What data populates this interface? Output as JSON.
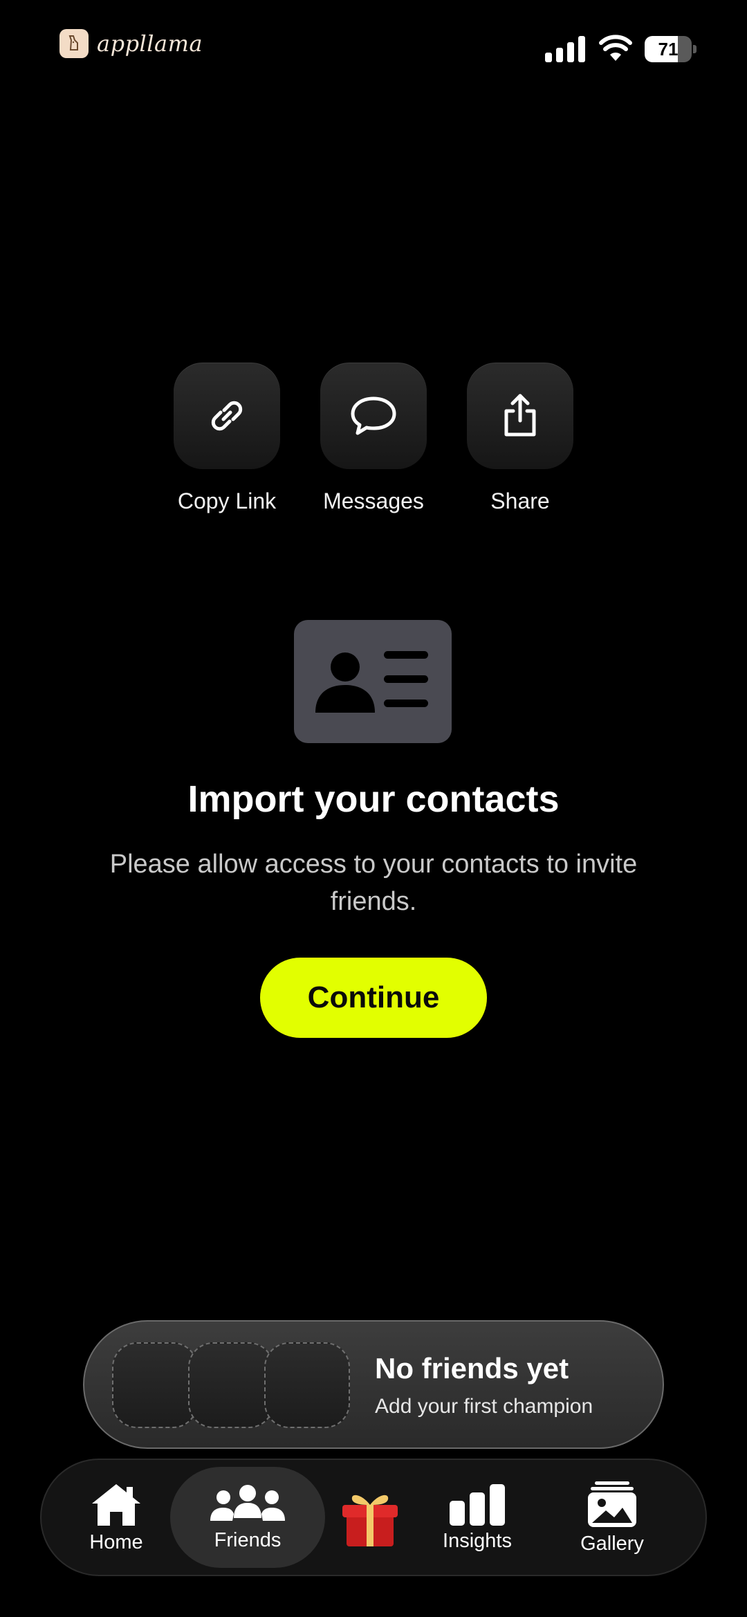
{
  "status_bar": {
    "brand": "appllama",
    "battery": "71",
    "battery_level": 0.71
  },
  "share_options": [
    {
      "label": "Copy Link",
      "icon": "link-icon"
    },
    {
      "label": "Messages",
      "icon": "chat-bubble-icon"
    },
    {
      "label": "Share",
      "icon": "share-icon"
    }
  ],
  "import": {
    "icon": "contact-card-icon",
    "title": "Import your contacts",
    "description": "Please allow access to your contacts to invite friends.",
    "button_label": "Continue"
  },
  "friends": {
    "title": "No friends yet",
    "subtitle": "Add your first champion"
  },
  "tabs": [
    {
      "label": "Home",
      "icon": "home-icon",
      "active": false
    },
    {
      "label": "Friends",
      "icon": "people-icon",
      "active": true
    },
    {
      "label": "",
      "icon": "gift-icon",
      "active": false
    },
    {
      "label": "Insights",
      "icon": "bar-chart-icon",
      "active": false
    },
    {
      "label": "Gallery",
      "icon": "gallery-icon",
      "active": false
    }
  ],
  "colors": {
    "accent": "#E2FF00",
    "background": "#000000",
    "card": "#4A4A52"
  }
}
